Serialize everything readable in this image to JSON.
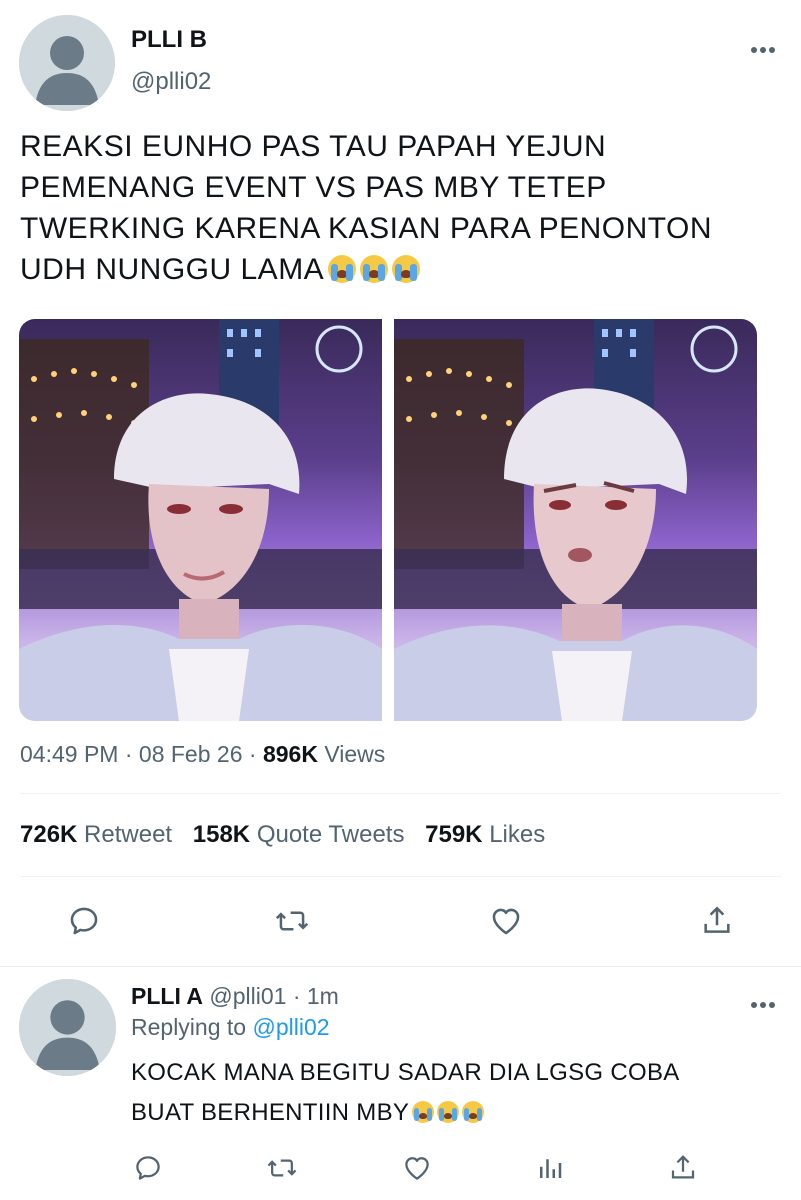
{
  "tweet": {
    "author_name": "PLLI B",
    "author_handle": "@plli02",
    "text": "REAKSI EUNHO PAS TAU PAPAH YEJUN PEMENANG EVENT VS PAS MBY TETEP TWERKING KARENA KASIAN PARA PENONTON UDH NUNGGU LAMA",
    "emoji_icon": "loudly-crying-face-icon",
    "images": [
      "smiling-white-haired-character",
      "confused-white-haired-character"
    ],
    "time": "04:49 PM",
    "date": "08 Feb 26",
    "sep": "·",
    "views_count": "896K",
    "views_label": "Views",
    "retweets_count": "726K",
    "retweets_label": "Retweet",
    "quotes_count": "158K",
    "quotes_label": "Quote Tweets",
    "likes_count": "759K",
    "likes_label": "Likes"
  },
  "reply": {
    "author_name": "PLLI A",
    "author_handle": "@plli01",
    "sep": "·",
    "time_ago": "1m",
    "replying_prefix": "Replying to",
    "replying_handle": "@plli02",
    "text": "KOCAK MANA BEGITU SADAR DIA LGSG COBA BUAT BERHENTIIN MBY"
  },
  "icons": {
    "more": "more-dots-icon",
    "reply": "reply-icon",
    "retweet": "retweet-icon",
    "like": "heart-icon",
    "share": "share-icon",
    "analytics": "analytics-icon"
  },
  "colors": {
    "text": "#0f1419",
    "muted": "#536471",
    "link": "#1d9bf0",
    "divider": "#eff3f4"
  }
}
